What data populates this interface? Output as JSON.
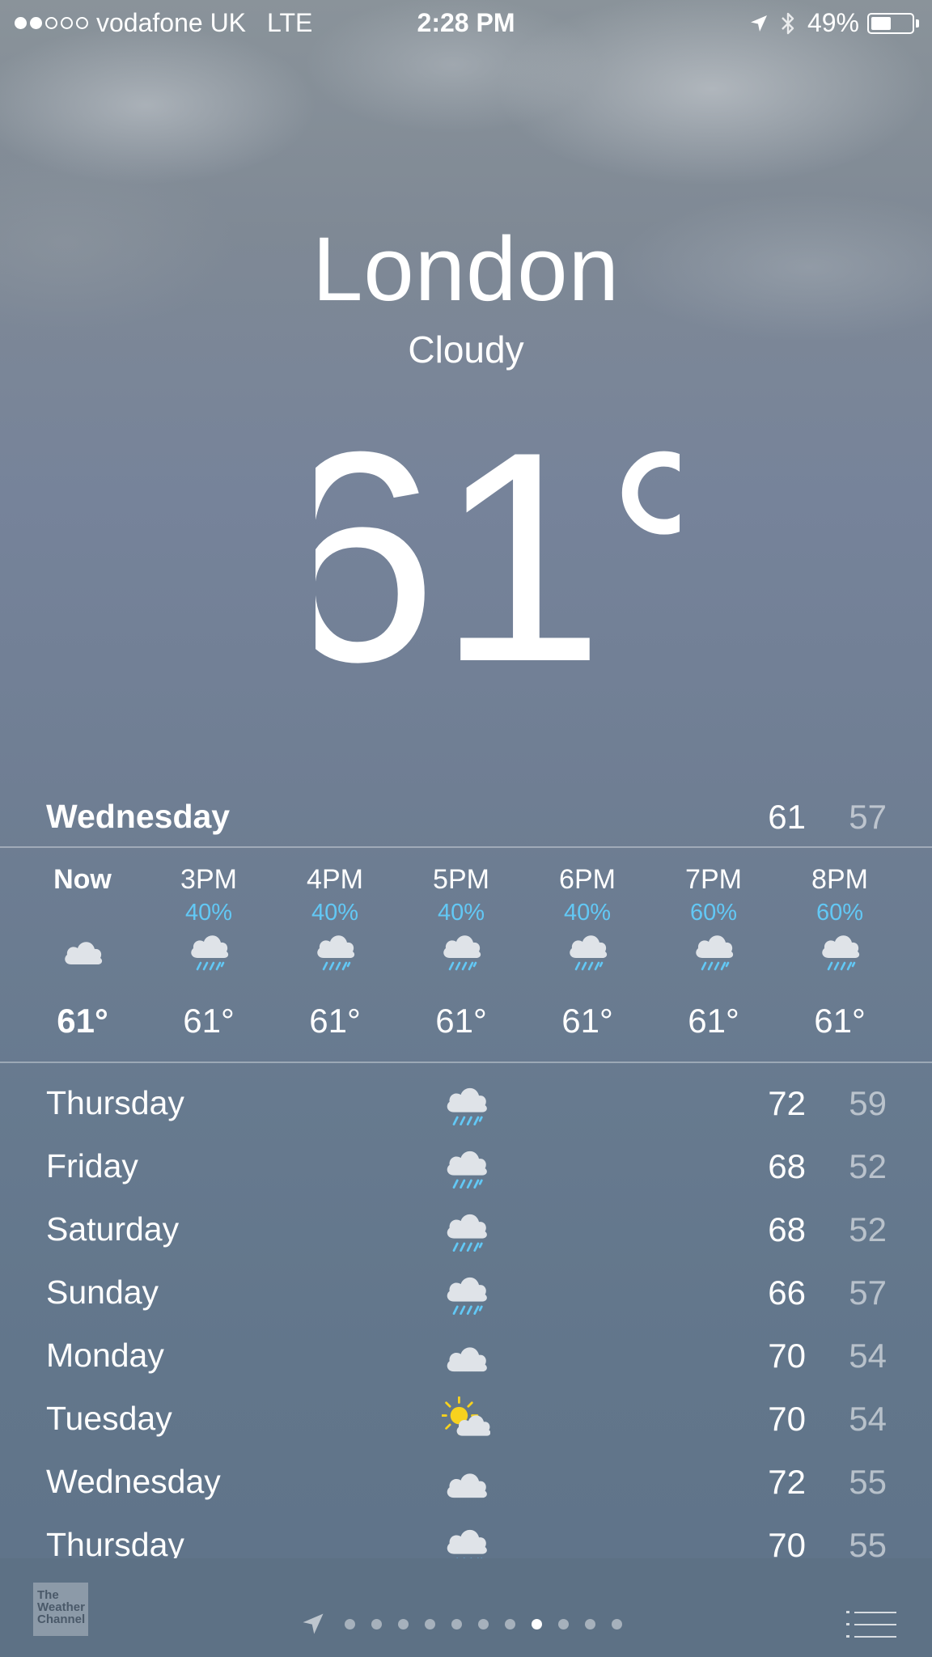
{
  "status_bar": {
    "signal_bars_filled": 2,
    "signal_bars_total": 5,
    "carrier": "vodafone UK",
    "network": "LTE",
    "time": "2:28 PM",
    "battery_percent": "49%",
    "battery_level": 0.49,
    "icons": [
      "location-arrow-icon",
      "bluetooth-icon",
      "battery-icon"
    ]
  },
  "weather": {
    "city": "London",
    "condition": "Cloudy",
    "temperature": "61",
    "degree_symbol": "°"
  },
  "today": {
    "day": "Wednesday",
    "high": "61",
    "low": "57"
  },
  "hourly": [
    {
      "time": "Now",
      "pop": "",
      "icon": "cloud-icon",
      "temp": "61°"
    },
    {
      "time": "3PM",
      "pop": "40%",
      "icon": "rain-cloud-icon",
      "temp": "61°"
    },
    {
      "time": "4PM",
      "pop": "40%",
      "icon": "rain-cloud-icon",
      "temp": "61°"
    },
    {
      "time": "5PM",
      "pop": "40%",
      "icon": "rain-cloud-icon",
      "temp": "61°"
    },
    {
      "time": "6PM",
      "pop": "40%",
      "icon": "rain-cloud-icon",
      "temp": "61°"
    },
    {
      "time": "7PM",
      "pop": "60%",
      "icon": "rain-cloud-icon",
      "temp": "61°"
    },
    {
      "time": "8PM",
      "pop": "60%",
      "icon": "rain-cloud-icon",
      "temp": "61°"
    }
  ],
  "daily": [
    {
      "day": "Thursday",
      "icon": "rain-cloud-icon",
      "high": "72",
      "low": "59"
    },
    {
      "day": "Friday",
      "icon": "rain-cloud-icon",
      "high": "68",
      "low": "52"
    },
    {
      "day": "Saturday",
      "icon": "rain-cloud-icon",
      "high": "68",
      "low": "52"
    },
    {
      "day": "Sunday",
      "icon": "rain-cloud-icon",
      "high": "66",
      "low": "57"
    },
    {
      "day": "Monday",
      "icon": "cloud-icon",
      "high": "70",
      "low": "54"
    },
    {
      "day": "Tuesday",
      "icon": "partly-sunny-icon",
      "high": "70",
      "low": "54"
    },
    {
      "day": "Wednesday",
      "icon": "cloud-icon",
      "high": "72",
      "low": "55"
    },
    {
      "day": "Thursday",
      "icon": "rain-cloud-icon",
      "high": "70",
      "low": "55"
    }
  ],
  "bottom_bar": {
    "logo_text": [
      "The",
      "Weather",
      "Channel"
    ],
    "page_count": 11,
    "active_page_index": 7,
    "icons": [
      "weather-channel-logo",
      "location-arrow-icon",
      "list-icon"
    ]
  },
  "colors": {
    "precipitation": "#62c8f5",
    "low_temp": "rgba(255,255,255,0.55)",
    "sun": "#f7d21e"
  }
}
